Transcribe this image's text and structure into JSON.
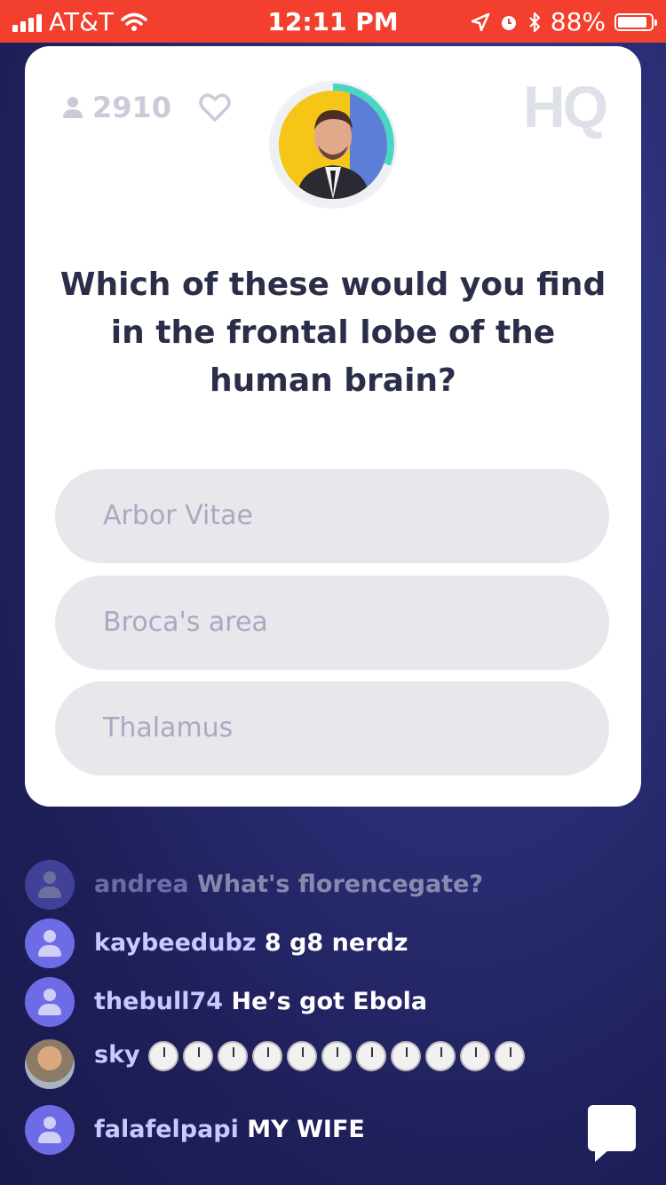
{
  "status_bar": {
    "carrier": "AT&T",
    "time": "12:11 PM",
    "battery": "88%",
    "battery_level": 0.88
  },
  "card": {
    "player_count": "2910",
    "logo": "HQ",
    "question": "Which of these would you find in the frontal lobe of the human brain?",
    "answers": [
      "Arbor Vitae",
      "Broca's area",
      "Thalamus"
    ]
  },
  "chat": {
    "messages": [
      {
        "user": "andrea",
        "text": "What's florencegate?"
      },
      {
        "user": "kaybeedubz",
        "text": "8 g8 nerdz"
      },
      {
        "user": "thebull74",
        "text": "He’s got Ebola"
      },
      {
        "user": "sky",
        "text": ""
      },
      {
        "user": "falafelpapi",
        "text": "MY WIFE"
      }
    ]
  },
  "colors": {
    "status_bar": "#f23f2e",
    "background": "#23245f",
    "answer_bg": "#e7e7ec",
    "avatar": "#6d6ce6"
  }
}
